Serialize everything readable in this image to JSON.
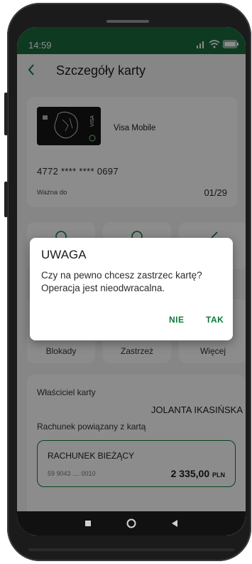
{
  "status_bar": {
    "time": "14:59",
    "battery": "100"
  },
  "header": {
    "back_icon": "chevron-left-icon",
    "title": "Szczegóły karty"
  },
  "card": {
    "name": "Visa Mobile",
    "brand": "VISA",
    "number": "4772 **** **** 0697",
    "valid_label": "Ważna do",
    "valid_value": "01/29"
  },
  "tiles_row1": [
    {
      "label": "",
      "icon": "tile-icon"
    },
    {
      "label": "",
      "icon": "tile-icon"
    },
    {
      "label": "",
      "icon": "tile-icon"
    }
  ],
  "tiles_row2": [
    {
      "label": "Blokady"
    },
    {
      "label": "Zastrzeż"
    },
    {
      "label": "Więcej"
    }
  ],
  "owner": {
    "label": "Właściciel karty",
    "value": "JOLANTA IKASIŃSKA",
    "account_label": "Rachunek powiązany z kartą",
    "account_name": "RACHUNEK BIEŻĄCY",
    "account_number": "59 9043 .... 0010",
    "account_balance": "2 335,00",
    "account_currency": "PLN"
  },
  "dialog": {
    "title": "UWAGA",
    "text": "Czy na pewno chcesz zastrzec kartę? Operacja jest nieodwracalna.",
    "no_label": "NIE",
    "yes_label": "TAK"
  },
  "navbar": {
    "recents_icon": "square-icon",
    "home_icon": "circle-icon",
    "back_icon": "triangle-back-icon"
  },
  "colors": {
    "accent": "#0a7a3a",
    "background": "#f2f4f3",
    "dialog_bg": "#ffffff"
  }
}
